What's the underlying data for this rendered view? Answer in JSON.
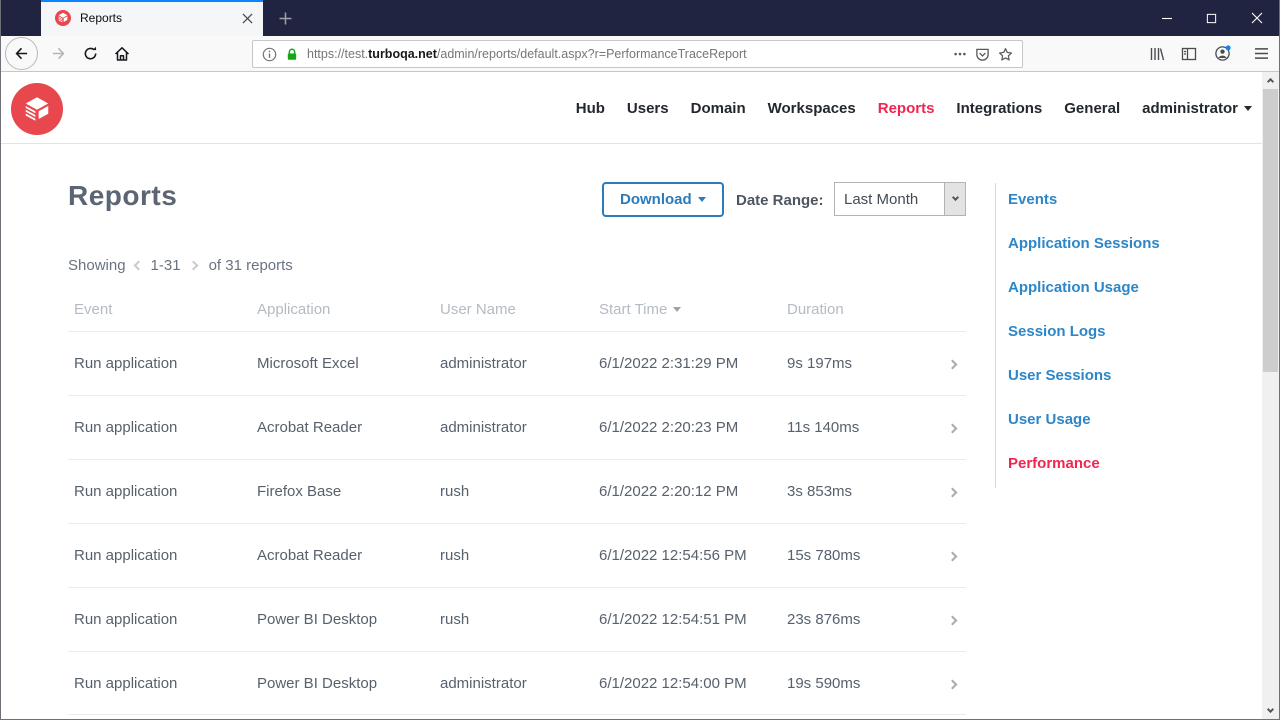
{
  "browser": {
    "tab": {
      "title": "Reports"
    },
    "url": {
      "scheme_prefix": "https://test.",
      "domain": "turboqa.net",
      "path": "/admin/reports/default.aspx?r=PerformanceTraceReport"
    }
  },
  "site_header": {
    "nav_items": [
      {
        "label": "Hub",
        "active": false
      },
      {
        "label": "Users",
        "active": false
      },
      {
        "label": "Domain",
        "active": false
      },
      {
        "label": "Workspaces",
        "active": false
      },
      {
        "label": "Reports",
        "active": true
      },
      {
        "label": "Integrations",
        "active": false
      },
      {
        "label": "General",
        "active": false
      }
    ],
    "user_menu_label": "administrator"
  },
  "page": {
    "title": "Reports",
    "download_button_label": "Download",
    "date_range_label": "Date Range:",
    "date_range_value": "Last Month",
    "pagination": {
      "showing_label": "Showing",
      "range": "1-31",
      "of_label": "of 31 reports"
    },
    "table": {
      "columns": [
        "Event",
        "Application",
        "User Name",
        "Start Time",
        "Duration"
      ],
      "sorted_column": "Start Time",
      "sort_direction": "descending",
      "rows": [
        {
          "event": "Run application",
          "application": "Microsoft Excel",
          "user": "administrator",
          "start": "6/1/2022 2:31:29 PM",
          "duration": "9s 197ms"
        },
        {
          "event": "Run application",
          "application": "Acrobat Reader",
          "user": "administrator",
          "start": "6/1/2022 2:20:23 PM",
          "duration": "11s 140ms"
        },
        {
          "event": "Run application",
          "application": "Firefox Base",
          "user": "rush",
          "start": "6/1/2022 2:20:12 PM",
          "duration": "3s 853ms"
        },
        {
          "event": "Run application",
          "application": "Acrobat Reader",
          "user": "rush",
          "start": "6/1/2022 12:54:56 PM",
          "duration": "15s 780ms"
        },
        {
          "event": "Run application",
          "application": "Power BI Desktop",
          "user": "rush",
          "start": "6/1/2022 12:54:51 PM",
          "duration": "23s 876ms"
        },
        {
          "event": "Run application",
          "application": "Power BI Desktop",
          "user": "administrator",
          "start": "6/1/2022 12:54:00 PM",
          "duration": "19s 590ms"
        }
      ]
    },
    "report_links": [
      {
        "label": "Events",
        "active": false
      },
      {
        "label": "Application Sessions",
        "active": false
      },
      {
        "label": "Application Usage",
        "active": false
      },
      {
        "label": "Session Logs",
        "active": false
      },
      {
        "label": "User Sessions",
        "active": false
      },
      {
        "label": "User Usage",
        "active": false
      },
      {
        "label": "Performance",
        "active": true
      }
    ]
  },
  "colors": {
    "brand_red": "#e8474d",
    "active_pink": "#f0264f",
    "link_blue": "#2d86c7",
    "download_blue": "#2b7cbc",
    "tab_accent_blue": "#0a84ff",
    "lock_green": "#14a714",
    "titlebar": "#212440"
  }
}
